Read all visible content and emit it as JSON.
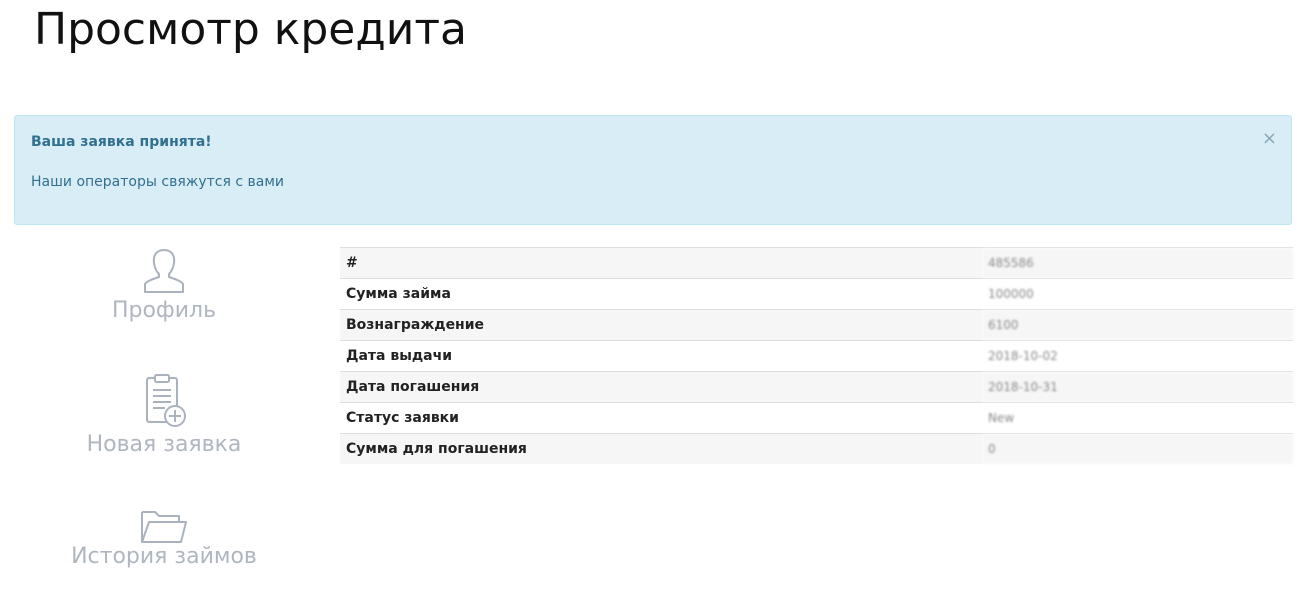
{
  "page": {
    "title": "Просмотр кредита"
  },
  "alert": {
    "title": "Ваша заявка принята!",
    "text": "Наши операторы свяжутся с вами",
    "close": "×"
  },
  "sidebar": {
    "items": [
      {
        "label": "Профиль",
        "icon": "user-icon"
      },
      {
        "label": "Новая заявка",
        "icon": "clipboard-add-icon"
      },
      {
        "label": "История займов",
        "icon": "folder-icon"
      }
    ]
  },
  "loan": {
    "rows": [
      {
        "key": "#",
        "value": "485586"
      },
      {
        "key": "Сумма займа",
        "value": "100000"
      },
      {
        "key": "Вознаграждение",
        "value": "6100"
      },
      {
        "key": "Дата выдачи",
        "value": "2018-10-02"
      },
      {
        "key": "Дата погашения",
        "value": "2018-10-31"
      },
      {
        "key": "Статус заявки",
        "value": "New"
      },
      {
        "key": "Сумма для погашения",
        "value": "0"
      }
    ]
  }
}
